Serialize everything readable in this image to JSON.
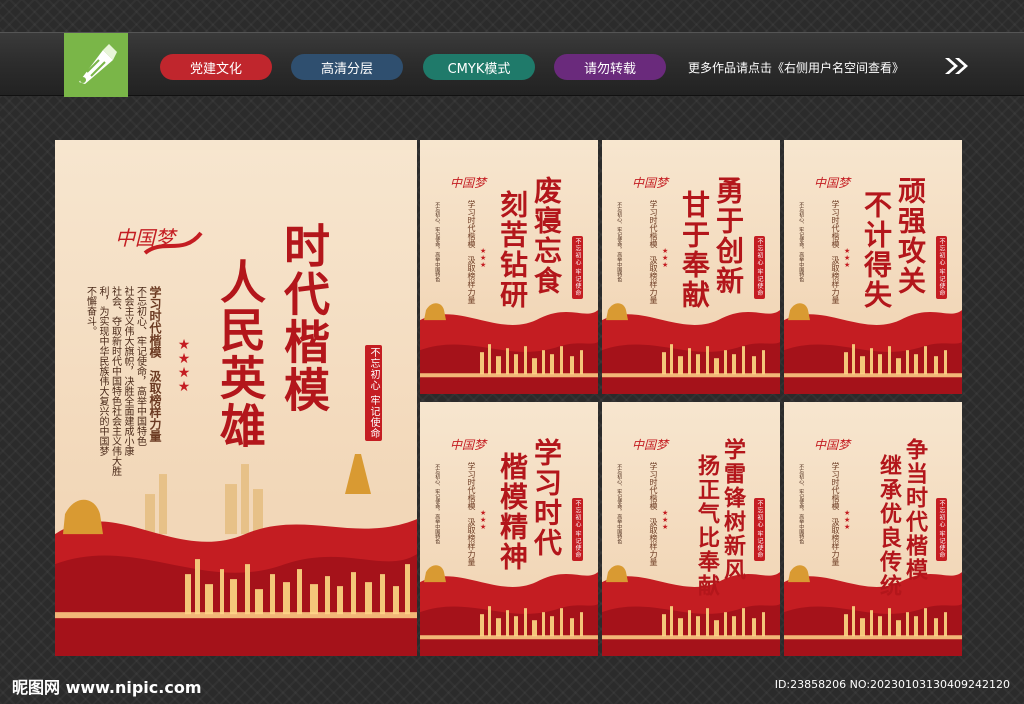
{
  "header": {
    "logo_icon": "pen-nib-icon",
    "tags": [
      {
        "label": "党建文化",
        "color": "#c0262d"
      },
      {
        "label": "高清分层",
        "color": "#2f4f6f"
      },
      {
        "label": "CMYK模式",
        "color": "#1f7a6a"
      },
      {
        "label": "请勿转载",
        "color": "#6a2a7c"
      }
    ],
    "more_text": "更多作品请点击《右侧用户名空间查看》",
    "arrow_icon": "double-chevron-right-icon"
  },
  "colors": {
    "red": "#c41d22",
    "cream": "#f7e6cf",
    "dark_bg": "#2b2b2b"
  },
  "main_poster": {
    "brand": "中国梦",
    "title_line1": "时代楷模",
    "title_line2": "人民英雄",
    "subtitle": "学习时代楷模　汲取榜样力量",
    "body": [
      "不忘初心、牢记使命，高举中国特色",
      "社会主义伟大旗帜，决胜全面建成小康",
      "社会、夺取新时代中国特色社会主义伟大胜",
      "利，为实现中华民族伟大复兴的中国梦",
      "不懈奋斗。"
    ],
    "seal": "不忘初心 牢记使命"
  },
  "small_posters": [
    {
      "brand": "中国梦",
      "title": [
        "废寝忘食",
        "刻苦钻研"
      ],
      "subtitle": "学习时代楷模　汲取榜样力量",
      "seal": "不忘初心 牢记使命"
    },
    {
      "brand": "中国梦",
      "title": [
        "勇于创新",
        "甘于奉献"
      ],
      "subtitle": "学习时代楷模　汲取榜样力量",
      "seal": "不忘初心 牢记使命"
    },
    {
      "brand": "中国梦",
      "title": [
        "顽强攻关",
        "不计得失"
      ],
      "subtitle": "学习时代楷模　汲取榜样力量",
      "seal": "不忘初心 牢记使命"
    },
    {
      "brand": "中国梦",
      "title": [
        "学习时代",
        "楷模精神"
      ],
      "subtitle": "学习时代楷模　汲取榜样力量",
      "seal": "不忘初心 牢记使命"
    },
    {
      "brand": "中国梦",
      "title": [
        "学雷锋树新风",
        "扬正气比奉献"
      ],
      "subtitle": "学习时代楷模　汲取榜样力量",
      "seal": "不忘初心 牢记使命"
    },
    {
      "brand": "中国梦",
      "title": [
        "争当时代楷模",
        "继承优良传统"
      ],
      "subtitle": "学习时代楷模　汲取榜样力量",
      "seal": "不忘初心 牢记使命"
    }
  ],
  "footer": {
    "site": "昵图网 www.nipic.com",
    "id_text": "ID:23858206 NO:20230103130409242120"
  }
}
